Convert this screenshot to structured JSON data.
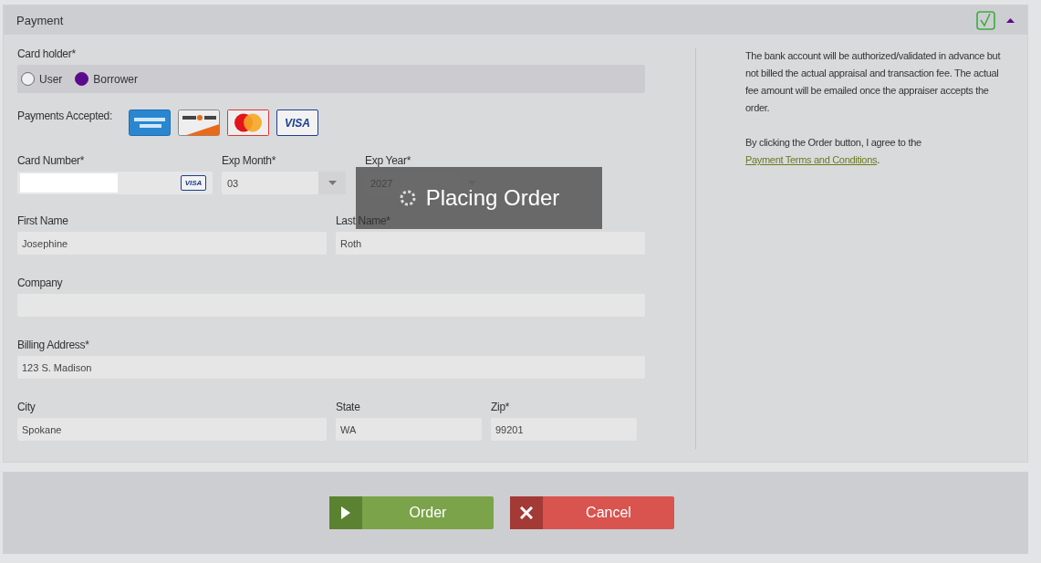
{
  "panel": {
    "title": "Payment",
    "complete": true,
    "expanded": true
  },
  "card_holder": {
    "label": "Card holder*",
    "options": [
      {
        "label": "User",
        "selected": false
      },
      {
        "label": "Borrower",
        "selected": true
      }
    ]
  },
  "payments_accepted": {
    "label": "Payments Accepted:",
    "cards": [
      {
        "kind": "amex"
      },
      {
        "kind": "discover"
      },
      {
        "kind": "mastercard"
      },
      {
        "kind": "visa",
        "label": "VISA"
      }
    ]
  },
  "card_number": {
    "label": "Card Number*",
    "brand": "VISA"
  },
  "exp_month": {
    "label": "Exp Month*",
    "value": "03"
  },
  "exp_year": {
    "label": "Exp Year*",
    "value": "2027"
  },
  "rows": [
    [
      {
        "label": "First Name",
        "value": "Josephine"
      },
      {
        "label": "Last Name*",
        "value": "Roth"
      }
    ],
    [
      {
        "label": "Company"
      }
    ],
    [
      {
        "label": "Billing Address*",
        "value": "123 S. Madison"
      }
    ],
    [
      {
        "label": "City",
        "value": "Spokane"
      },
      {
        "label": "State",
        "value": "WA"
      },
      {
        "label": "Zip*",
        "value": "99201"
      }
    ]
  ],
  "notice": "The bank account will be authorized/validated in advance but not billed the actual appraisal and transaction fee. The actual fee amount will be emailed once the appraiser accepts the order.",
  "agreement": {
    "text": "By clicking the Order button, I agree to the",
    "link": "Payment Terms and Conditions",
    "end": "."
  },
  "overlay": {
    "text": "Placing Order"
  },
  "buttons": [
    {
      "kind": "order",
      "label": "Order"
    },
    {
      "kind": "cancel",
      "label": "Cancel"
    }
  ]
}
